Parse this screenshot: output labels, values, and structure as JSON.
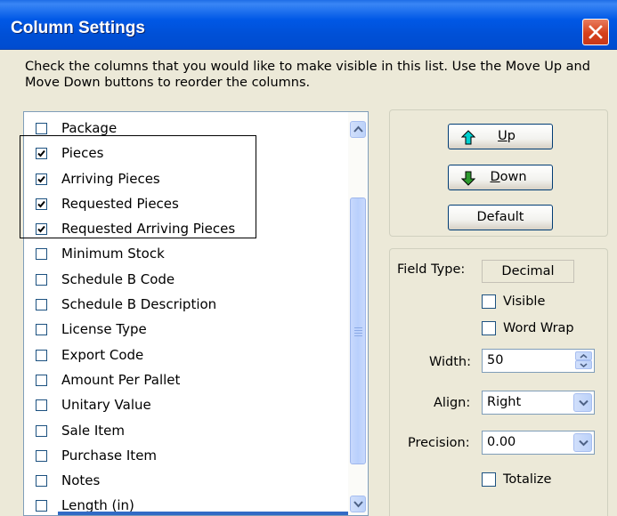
{
  "window": {
    "title": "Column Settings"
  },
  "instructions": "Check the columns that you would like to make visible in this list. Use the Move Up and  Move Down buttons to reorder the columns.",
  "columns": [
    {
      "label": "Package",
      "checked": false
    },
    {
      "label": "Pieces",
      "checked": true
    },
    {
      "label": "Arriving Pieces",
      "checked": true
    },
    {
      "label": "Requested Pieces",
      "checked": true
    },
    {
      "label": "Requested Arriving Pieces",
      "checked": true
    },
    {
      "label": "Minimum Stock",
      "checked": false
    },
    {
      "label": "Schedule B Code",
      "checked": false
    },
    {
      "label": "Schedule B Description",
      "checked": false
    },
    {
      "label": "License Type",
      "checked": false
    },
    {
      "label": "Export Code",
      "checked": false
    },
    {
      "label": "Amount Per Pallet",
      "checked": false
    },
    {
      "label": "Unitary Value",
      "checked": false
    },
    {
      "label": "Sale Item",
      "checked": false
    },
    {
      "label": "Purchase Item",
      "checked": false
    },
    {
      "label": "Notes",
      "checked": false
    },
    {
      "label": "Length (in)",
      "checked": false
    }
  ],
  "buttons": {
    "up_first": "U",
    "up_rest": "p",
    "down_first": "D",
    "down_rest": "own",
    "default": "Default"
  },
  "properties": {
    "field_type_label": "Field Type:",
    "field_type_value": "Decimal",
    "visible_label": "Visible",
    "visible_checked": false,
    "word_wrap_label": "Word Wrap",
    "word_wrap_checked": false,
    "width_label": "Width:",
    "width_value": "50",
    "align_label": "Align:",
    "align_value": "Right",
    "precision_label": "Precision:",
    "precision_value": "0.00",
    "totalize_label": "Totalize",
    "totalize_checked": false
  },
  "colors": {
    "title_bar": "#0054E3",
    "selection": "#316AC5",
    "up_arrow": "#00C0C0",
    "down_arrow": "#1F7A1F"
  }
}
